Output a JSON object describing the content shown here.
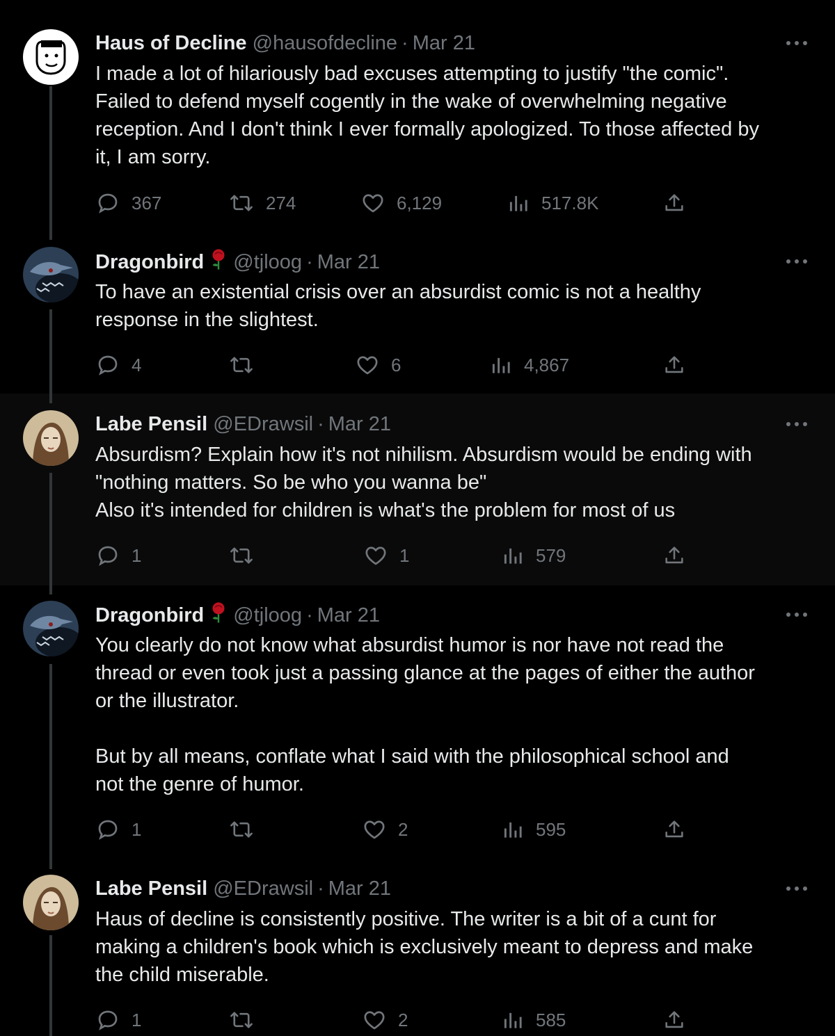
{
  "tweets": [
    {
      "name": "Haus of Decline",
      "handle": "@hausofdecline",
      "sep": "·",
      "date": "Mar 21",
      "rose": false,
      "text": "I made a lot of hilariously bad excuses attempting to justify \"the comic\".\nFailed to defend myself cogently in the wake of overwhelming negative\nreception. And I don't think I ever formally apologized. To those affected by\nit, I am sorry.",
      "replies": "367",
      "reposts": "274",
      "likes": "6,129",
      "views": "517.8K",
      "avatar": "cartoon-face"
    },
    {
      "name": "Dragonbird",
      "handle": "@tjloog",
      "sep": "·",
      "date": "Mar 21",
      "rose": true,
      "text": "To have an existential crisis over an absurdist comic is not a healthy\nresponse in the slightest.",
      "replies": "4",
      "reposts": "",
      "likes": "6",
      "views": "4,867",
      "avatar": "loon-bird"
    },
    {
      "name": "Labe Pensil",
      "handle": "@EDrawsil",
      "sep": "·",
      "date": "Mar 21",
      "rose": false,
      "text": "Absurdism? Explain how it's not nihilism. Absurdism would be ending with\n\"nothing matters. So be who you wanna be\"\nAlso it's intended for children is what's the problem for most of us",
      "replies": "1",
      "reposts": "",
      "likes": "1",
      "views": "579",
      "avatar": "portrait"
    },
    {
      "name": "Dragonbird",
      "handle": "@tjloog",
      "sep": "·",
      "date": "Mar 21",
      "rose": true,
      "text": "You clearly do not know what absurdist humor is nor have not read the\nthread or even took just a passing glance at the pages of either the author\nor the illustrator.\n\nBut by all means, conflate what I said with the philosophical school and\nnot the genre of humor.",
      "replies": "1",
      "reposts": "",
      "likes": "2",
      "views": "595",
      "avatar": "loon-bird"
    },
    {
      "name": "Labe Pensil",
      "handle": "@EDrawsil",
      "sep": "·",
      "date": "Mar 21",
      "rose": false,
      "text": "Haus of decline is consistently positive. The writer is a bit of a cunt for\nmaking a children's book which is exclusively meant to depress and make\nthe child miserable.",
      "replies": "1",
      "reposts": "",
      "likes": "2",
      "views": "585",
      "avatar": "portrait"
    }
  ],
  "colors": {
    "text": "#e7e9ea",
    "muted": "#71767b",
    "line": "#333639",
    "highlight": "#0a0a0a",
    "rose": "#c0111f"
  }
}
